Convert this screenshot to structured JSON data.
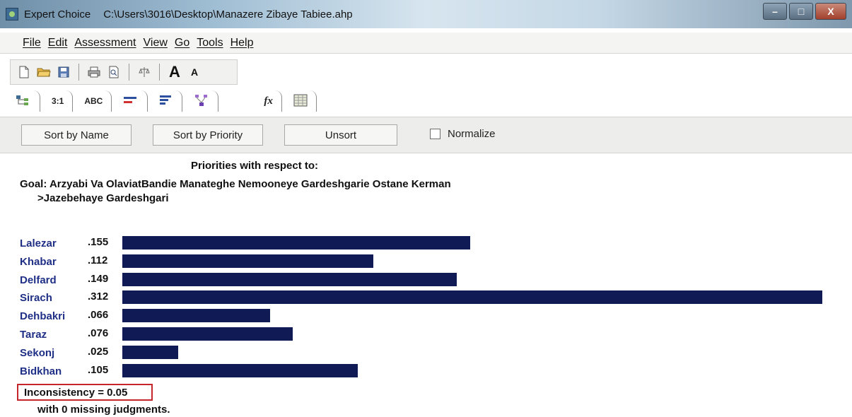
{
  "window": {
    "app_name": "Expert Choice",
    "file_path": "C:\\Users\\3016\\Desktop\\Manazere Zibaye Tabiee.ahp",
    "minimize": "–",
    "restore": "□",
    "close": "X"
  },
  "menu": [
    "File",
    "Edit",
    "Assessment",
    "View",
    "Go",
    "Tools",
    "Help"
  ],
  "toolbar": {
    "icons": [
      "new-document-icon",
      "open-folder-icon",
      "save-icon",
      "print-icon",
      "print-preview-icon",
      "balance-icon"
    ],
    "font_larger": "A",
    "font_smaller": "A"
  },
  "tabs": [
    {
      "name": "tree-view-tab",
      "label": ""
    },
    {
      "name": "ratio-tab",
      "label": "3:1"
    },
    {
      "name": "abc-tab",
      "label": "ABC"
    },
    {
      "name": "bars-red-tab",
      "label": ""
    },
    {
      "name": "bars-blue-tab",
      "label": ""
    },
    {
      "name": "hierarchy-tab",
      "label": ""
    },
    {
      "name": "formula-tab",
      "label": "fx"
    },
    {
      "name": "grid-tab",
      "label": ""
    }
  ],
  "buttons": {
    "sort_by_name": "Sort by Name",
    "sort_by_priority": "Sort by Priority",
    "unsort": "Unsort",
    "normalize": "Normalize"
  },
  "content": {
    "heading": "Priorities with respect to:",
    "goal": "Goal: Arzyabi Va OlaviatBandie Manateghe Nemooneye Gardeshgarie Ostane Kerman",
    "subgoal": ">Jazebehaye Gardeshgari",
    "inconsistency": "Inconsistency = 0.05",
    "missing": "with 0  missing judgments."
  },
  "colors": {
    "bar": "#101a55",
    "name_text": "#1f2f86",
    "highlight_border": "#c4262b"
  },
  "chart_data": {
    "type": "bar",
    "categories": [
      "Lalezar",
      "Khabar",
      "Delfard",
      "Sirach",
      "Dehbakri",
      "Taraz",
      "Sekonj",
      "Bidkhan"
    ],
    "labels": [
      ".155",
      ".112",
      ".149",
      ".312",
      ".066",
      ".076",
      ".025",
      ".105"
    ],
    "values": [
      0.155,
      0.112,
      0.149,
      0.312,
      0.066,
      0.076,
      0.025,
      0.105
    ],
    "orientation": "horizontal",
    "xlim": [
      0,
      0.312
    ]
  }
}
